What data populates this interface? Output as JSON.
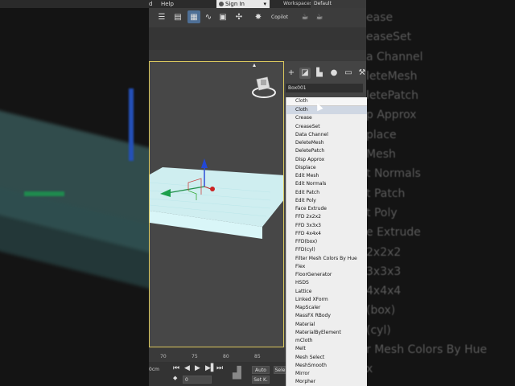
{
  "menubar": {
    "help_label": "Help",
    "d_label": "d",
    "sign_in_label": "Sign In",
    "workspaces_label": "Workspaces:",
    "workspace_value": "Default"
  },
  "toolbar": {
    "copilot_label": "Copilot"
  },
  "command_panel": {
    "object_name": "Box001"
  },
  "modifier_list": {
    "header": "Cloth",
    "items": [
      "Cloth",
      "Crease",
      "CreaseSet",
      "Data Channel",
      "DeleteMesh",
      "DeletePatch",
      "Disp Approx",
      "Displace",
      "Edit Mesh",
      "Edit Normals",
      "Edit Patch",
      "Edit Poly",
      "Face Extrude",
      "FFD 2x2x2",
      "FFD 3x3x3",
      "FFD 4x4x4",
      "FFD(box)",
      "FFD(cyl)",
      "Filter Mesh Colors By Hue",
      "Flex",
      "FloorGenerator",
      "HSDS",
      "Lattice",
      "Linked XForm",
      "MapScaler",
      "MassFX RBody",
      "Material",
      "MaterialByElement",
      "mCloth",
      "Melt",
      "Mesh Select",
      "MeshSmooth",
      "Mirror",
      "Morpher"
    ],
    "selected_index": 0
  },
  "timeline": {
    "ticks": [
      "70",
      "75",
      "80",
      "85",
      "90"
    ]
  },
  "statusbar": {
    "units": "0cm",
    "frame_value": "0",
    "auto_label": "Auto",
    "setk_label": "Set K.",
    "sel_label": "Sele"
  },
  "blurred_bg": {
    "items": [
      "ease",
      "easeSet",
      "a Channel",
      "leteMesh",
      "letePatch",
      "p Approx",
      "place",
      "Mesh",
      "t Normals",
      "t Patch",
      "t Poly",
      "e Extrude",
      "2x2x2",
      "3x3x3",
      "4x4x4",
      "(box)",
      "(cyl)",
      "r Mesh Colors By Hue",
      "x"
    ]
  }
}
